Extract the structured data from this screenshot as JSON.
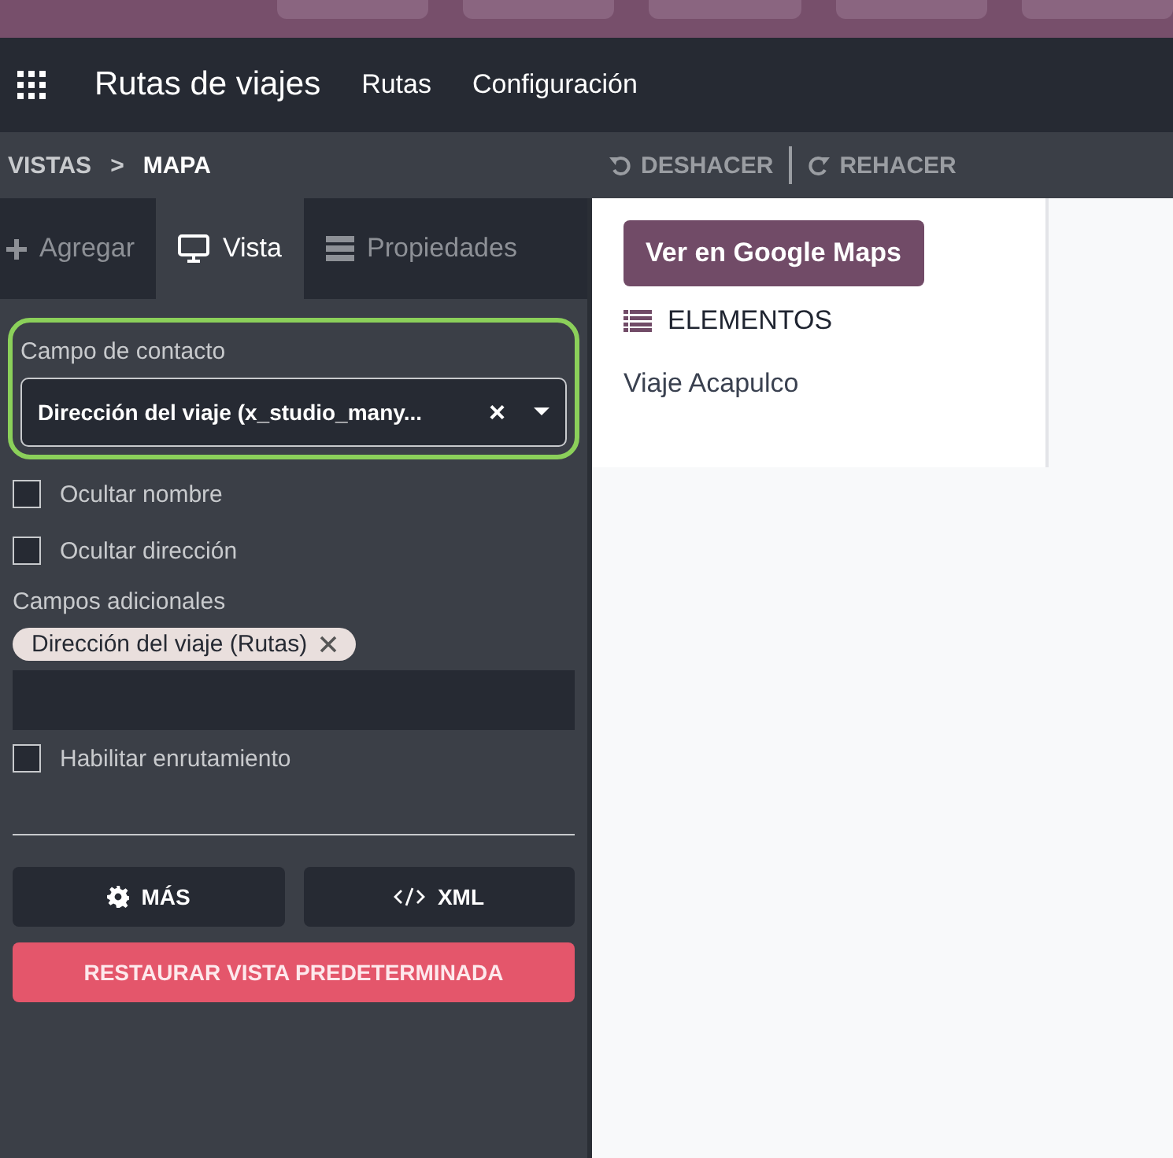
{
  "navbar": {
    "app_title": "Rutas de viajes",
    "menus": [
      "Rutas",
      "Configuración"
    ]
  },
  "breadcrumb": {
    "items": [
      "VISTAS",
      "MAPA"
    ],
    "separator": ">"
  },
  "history": {
    "undo": "DESHACER",
    "redo": "REHACER"
  },
  "sidebar": {
    "tabs": [
      {
        "label": "Agregar",
        "selected": false
      },
      {
        "label": "Vista",
        "selected": true
      },
      {
        "label": "Propiedades",
        "selected": false
      }
    ],
    "contact_field": {
      "label": "Campo de contacto",
      "value": "Dirección del viaje (x_studio_many...",
      "clear": "×"
    },
    "options": [
      {
        "kind": "checkbox",
        "label": "Ocultar nombre",
        "checked": false
      },
      {
        "kind": "checkbox",
        "label": "Ocultar dirección",
        "checked": false
      },
      {
        "kind": "tags",
        "label": "Campos adicionales",
        "tags": [
          "Dirección del viaje (Rutas)"
        ]
      },
      {
        "kind": "checkbox",
        "label": "Habilitar enrutamiento",
        "checked": false
      }
    ],
    "buttons": [
      {
        "kind": "more",
        "label": "MÁS"
      },
      {
        "kind": "xml",
        "label": "XML"
      }
    ],
    "reset_button": "RESTAURAR VISTA PREDETERMINADA"
  },
  "map_panel": {
    "button": "Ver en Google Maps",
    "section_title": "ELEMENTOS",
    "items": [
      "Viaje Acapulco"
    ]
  }
}
